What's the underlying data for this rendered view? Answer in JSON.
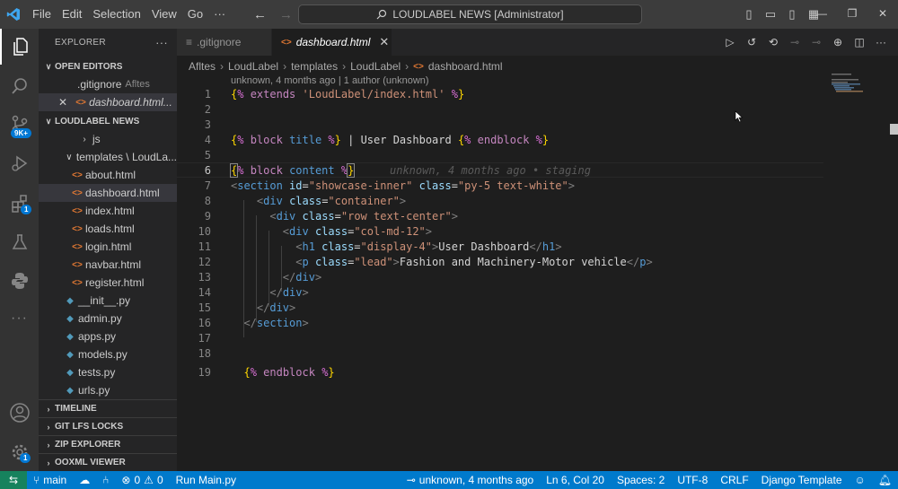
{
  "titlebar": {
    "menu": [
      "File",
      "Edit",
      "Selection",
      "View",
      "Go",
      "···"
    ],
    "search": "LOUDLABEL NEWS [Administrator]"
  },
  "activity": {
    "source_control_badge": "9K+",
    "extensions_badge": "1",
    "settings_badge": "1"
  },
  "sidebar": {
    "header": "EXPLORER",
    "open_editors_label": "OPEN EDITORS",
    "open_editors": [
      {
        "name": ".gitignore",
        "sub": "Afltes"
      },
      {
        "name": "dashboard.html...",
        "sub": ""
      }
    ],
    "project_label": "LOUDLABEL NEWS",
    "tree": {
      "js_folder": "js",
      "templates_folder": "templates \\ LoudLa...",
      "files": [
        "about.html",
        "dashboard.html",
        "index.html",
        "loads.html",
        "login.html",
        "navbar.html",
        "register.html"
      ],
      "py_files": [
        "__init__.py",
        "admin.py",
        "apps.py",
        "models.py",
        "tests.py",
        "urls.py"
      ]
    },
    "bottom_sections": [
      "TIMELINE",
      "GIT LFS LOCKS",
      "ZIP EXPLORER",
      "OOXML VIEWER"
    ]
  },
  "tabs": [
    {
      "label": ".gitignore"
    },
    {
      "label": "dashboard.html"
    }
  ],
  "breadcrumb": [
    "Afltes",
    "LoudLabel",
    "templates",
    "LoudLabel",
    "dashboard.html"
  ],
  "codelens": "unknown, 4 months ago | 1 author (unknown)",
  "blame": "unknown, 4 months ago • staging",
  "code": {
    "line_numbers": [
      "1",
      "2",
      "3",
      "4",
      "5",
      "6",
      "7",
      "8",
      "9",
      "10",
      "11",
      "12",
      "13",
      "14",
      "15",
      "16",
      "17",
      "18",
      "19"
    ],
    "extends_path": "'LoudLabel/index.html'",
    "title_text": " User Dashboard ",
    "h1_text": "User Dashboard",
    "p_text": "Fashion and Machinery-Motor vehicle"
  },
  "statusbar": {
    "branch": "main",
    "problems": "0",
    "warnings": "0",
    "run": "Run Main.py",
    "blame": "unknown, 4 months ago",
    "position": "Ln 6, Col 20",
    "spaces": "Spaces: 2",
    "encoding": "UTF-8",
    "eol": "CRLF",
    "language": "Django Template"
  },
  "colors": {
    "accent": "#007acc",
    "remote": "#16825d",
    "badge": "#0078d4"
  }
}
